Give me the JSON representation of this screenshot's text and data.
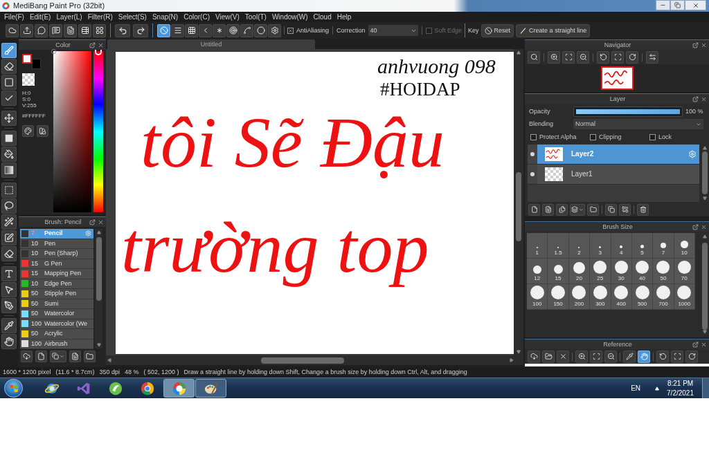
{
  "window": {
    "title": "MediBang Paint Pro (32bit)"
  },
  "menu": [
    "File(F)",
    "Edit(E)",
    "Layer(L)",
    "Filter(R)",
    "Select(S)",
    "Snap(N)",
    "Color(C)",
    "View(V)",
    "Tool(T)",
    "Window(W)",
    "Cloud",
    "Help"
  ],
  "toolbar": {
    "snap_tools": [
      {
        "selected": true
      },
      {
        "selected": false
      },
      {
        "selected": false
      },
      {
        "selected": false
      },
      {
        "selected": false
      },
      {
        "selected": false
      },
      {
        "selected": false
      },
      {
        "selected": false
      },
      {
        "selected": false
      }
    ],
    "antialiasing": {
      "label": "AntiAliasing",
      "checked": true
    },
    "correction": {
      "label": "Correction",
      "value": "40"
    },
    "soft_edge": {
      "label": "Soft Edge",
      "checked": false,
      "disabled": true
    },
    "key_label": "Key",
    "buttons": [
      "Reset",
      "Create a straight line"
    ]
  },
  "tools": [
    {
      "selected": true
    },
    {
      "selected": false
    },
    {
      "selected": false
    },
    {
      "selected": false
    },
    {
      "selected": false
    },
    {
      "selected": false
    },
    {
      "selected": false
    },
    {
      "selected": false
    },
    {
      "selected": false
    },
    {
      "selected": false
    },
    {
      "selected": false
    },
    {
      "selected": false
    },
    {
      "selected": false
    },
    {
      "selected": false
    },
    {
      "selected": false
    },
    {
      "selected": false
    },
    {
      "selected": false
    },
    {
      "selected": false
    }
  ],
  "color_panel": {
    "title": "Color",
    "swatches": [
      {
        "color": "#ffffff",
        "selected": true
      },
      {
        "color": "#000000",
        "selected": false
      }
    ],
    "readout": [
      "H:0",
      "S:0",
      "V:255"
    ],
    "hex": "#FFFFFF"
  },
  "brush_panel": {
    "title": "Brush: Pencil",
    "brushes": [
      {
        "size": "7",
        "name": "Pencil",
        "color": "#333333",
        "selected": true
      },
      {
        "size": "10",
        "name": "Pen",
        "color": "#333333",
        "selected": false
      },
      {
        "size": "10",
        "name": "Pen (Sharp)",
        "color": "#333333",
        "selected": false
      },
      {
        "size": "15",
        "name": "G Pen",
        "color": "#ee3333",
        "selected": false
      },
      {
        "size": "15",
        "name": "Mapping Pen",
        "color": "#ee3333",
        "selected": false
      },
      {
        "size": "10",
        "name": "Edge Pen",
        "color": "#22bb22",
        "selected": false
      },
      {
        "size": "50",
        "name": "Stipple Pen",
        "color": "#eecc11",
        "selected": false
      },
      {
        "size": "50",
        "name": "Sumi",
        "color": "#eecc11",
        "selected": false
      },
      {
        "size": "50",
        "name": "Watercolor",
        "color": "#77ddff",
        "selected": false
      },
      {
        "size": "100",
        "name": "Watercolor (We",
        "color": "#77ddff",
        "selected": false
      },
      {
        "size": "50",
        "name": "Acrylic",
        "color": "#eecc11",
        "selected": false
      },
      {
        "size": "100",
        "name": "Airbrush",
        "color": "#dddddd",
        "selected": false
      }
    ]
  },
  "canvas": {
    "tab": "Untitled",
    "strokes": [
      {
        "text": "anhvuong 098",
        "color": "#111111"
      },
      {
        "text": "#HOIDAP",
        "color": "#111111"
      },
      {
        "text": "tôi Sẽ Đậu",
        "color": "#ee1111"
      },
      {
        "text": "trường top",
        "color": "#ee1111"
      }
    ]
  },
  "navigator": {
    "title": "Navigator"
  },
  "layer_panel": {
    "title": "Layer",
    "opacity": {
      "label": "Opacity",
      "level": 1,
      "reading": "100 %"
    },
    "blending": {
      "label": "Blending",
      "value": "Normal"
    },
    "options": [
      {
        "label": "Protect Alpha",
        "checked": false
      },
      {
        "label": "Clipping",
        "checked": false
      },
      {
        "label": "Lock",
        "checked": false
      }
    ],
    "layers": [
      {
        "name": "Layer2",
        "selected": true,
        "visible": true
      },
      {
        "name": "Layer1",
        "selected": false,
        "visible": true
      }
    ]
  },
  "brush_size_panel": {
    "title": "Brush Size",
    "sizes": [
      "1",
      "1.5",
      "2",
      "3",
      "4",
      "5",
      "7",
      "10",
      "12",
      "15",
      "20",
      "25",
      "30",
      "40",
      "50",
      "70",
      "100",
      "150",
      "200",
      "300",
      "400",
      "500",
      "700",
      "1000"
    ]
  },
  "reference_panel": {
    "title": "Reference",
    "tools": [
      {
        "selected": false
      },
      {
        "selected": false
      },
      {
        "selected": false
      },
      {
        "selected": false
      },
      {
        "selected": false
      },
      {
        "selected": false
      },
      {
        "selected": false
      },
      {
        "selected": true
      },
      {
        "selected": false
      },
      {
        "selected": false
      },
      {
        "selected": false
      }
    ]
  },
  "status_bar": [
    "1600 * 1200 pixel",
    "(11.6 * 8.7cm)",
    "350 dpi",
    "48 %",
    "( 502, 1200 )",
    "Draw a straight line by holding down Shift, Change a brush size by holding down Ctrl, Alt, and dragging"
  ],
  "taskbar": {
    "apps": [
      {
        "running": false,
        "selected": false
      },
      {
        "running": false,
        "selected": false
      },
      {
        "running": false,
        "selected": false
      },
      {
        "running": false,
        "selected": false
      },
      {
        "running": true,
        "selected": true
      },
      {
        "running": true,
        "selected": false
      }
    ],
    "language": "EN",
    "time": "8:21 PM",
    "date": "7/2/2021"
  }
}
